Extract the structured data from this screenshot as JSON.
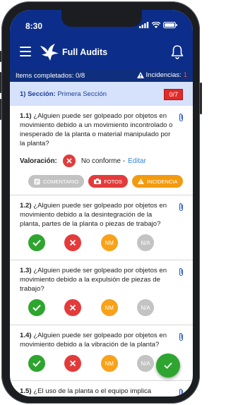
{
  "status": {
    "time": "8:30"
  },
  "app": {
    "title": "Full Audits"
  },
  "summary": {
    "completed": "Items completados: 0/8",
    "incidents_label": "Incidencias:",
    "incidents_count": "1"
  },
  "section": {
    "number": "1) Sección:",
    "name": "Primera Sección",
    "count": "0/7"
  },
  "questions": [
    {
      "num": "1.1)",
      "text": "¿Alguien puede ser golpeado por objetos en movimiento debido a un movimiento incontrolado o inesperado de la planta o material manipulado por la planta?",
      "valoracion_label": "Valoración:",
      "valoracion_value": "No conforme",
      "edit_label": "Editar",
      "buttons": {
        "comment": "COMENTARIO",
        "photos": "FOTOS",
        "incident": "INCIDENCIA"
      }
    },
    {
      "num": "1.2)",
      "text": "¿Alguien puede ser golpeado por objetos en movimiento debido a la desintegración de la planta, partes de la planta o piezas de trabajo?"
    },
    {
      "num": "1.3)",
      "text": "¿Alguien puede ser golpeado por objetos en movimiento debido a la expulsión de piezas de trabajo?"
    },
    {
      "num": "1.4)",
      "text": "¿Alguien puede ser golpeado por objetos en movimiento debido a la vibración de la planta?"
    },
    {
      "num": "1.5)",
      "text": "¿El uso de la planta o el equipo implica posturas repetitivas o sostenidas que representan un"
    }
  ],
  "options": {
    "nm": "NM",
    "na": "N/A"
  },
  "colors": {
    "primary": "#0c2e8a",
    "section_bg": "#d6e2fb",
    "ok": "#2ea52e",
    "no": "#e33b3b",
    "nm": "#f7a21a",
    "na": "#c3c3c3"
  }
}
